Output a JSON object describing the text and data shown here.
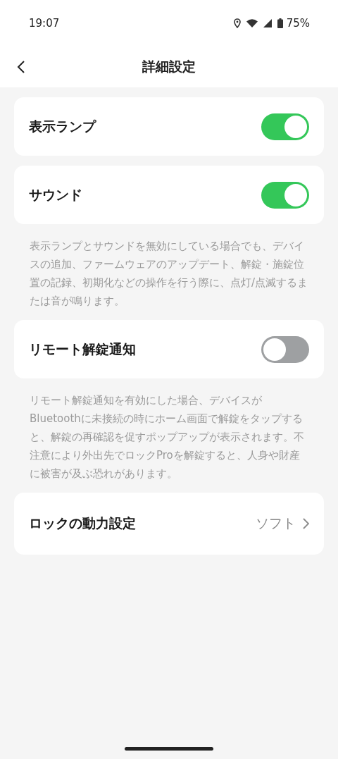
{
  "status_bar": {
    "time": "19:07",
    "battery": "75%"
  },
  "header": {
    "title": "詳細設定"
  },
  "items": [
    {
      "kind": "toggle",
      "label": "表示ランプ",
      "on": true
    },
    {
      "kind": "toggle",
      "label": "サウンド",
      "on": true
    },
    {
      "kind": "note",
      "text": "表示ランプとサウンドを無効にしている場合でも、デバイスの追加、ファームウェアのアップデート、解錠・施錠位置の記録、初期化などの操作を行う際に、点灯/点滅するまたは音が鳴ります。"
    },
    {
      "kind": "toggle",
      "label": "リモート解錠通知",
      "on": false
    },
    {
      "kind": "note",
      "text": "リモート解錠通知を有効にした場合、デバイスがBluetoothに未接続の時にホーム画面で解錠をタップすると、解錠の再確認を促すポップアップが表示されます。不注意により外出先でロックProを解錠すると、人身や財産に被害が及ぶ恐れがあります。"
    },
    {
      "kind": "value",
      "label": "ロックの動力設定",
      "value": "ソフト"
    }
  ]
}
